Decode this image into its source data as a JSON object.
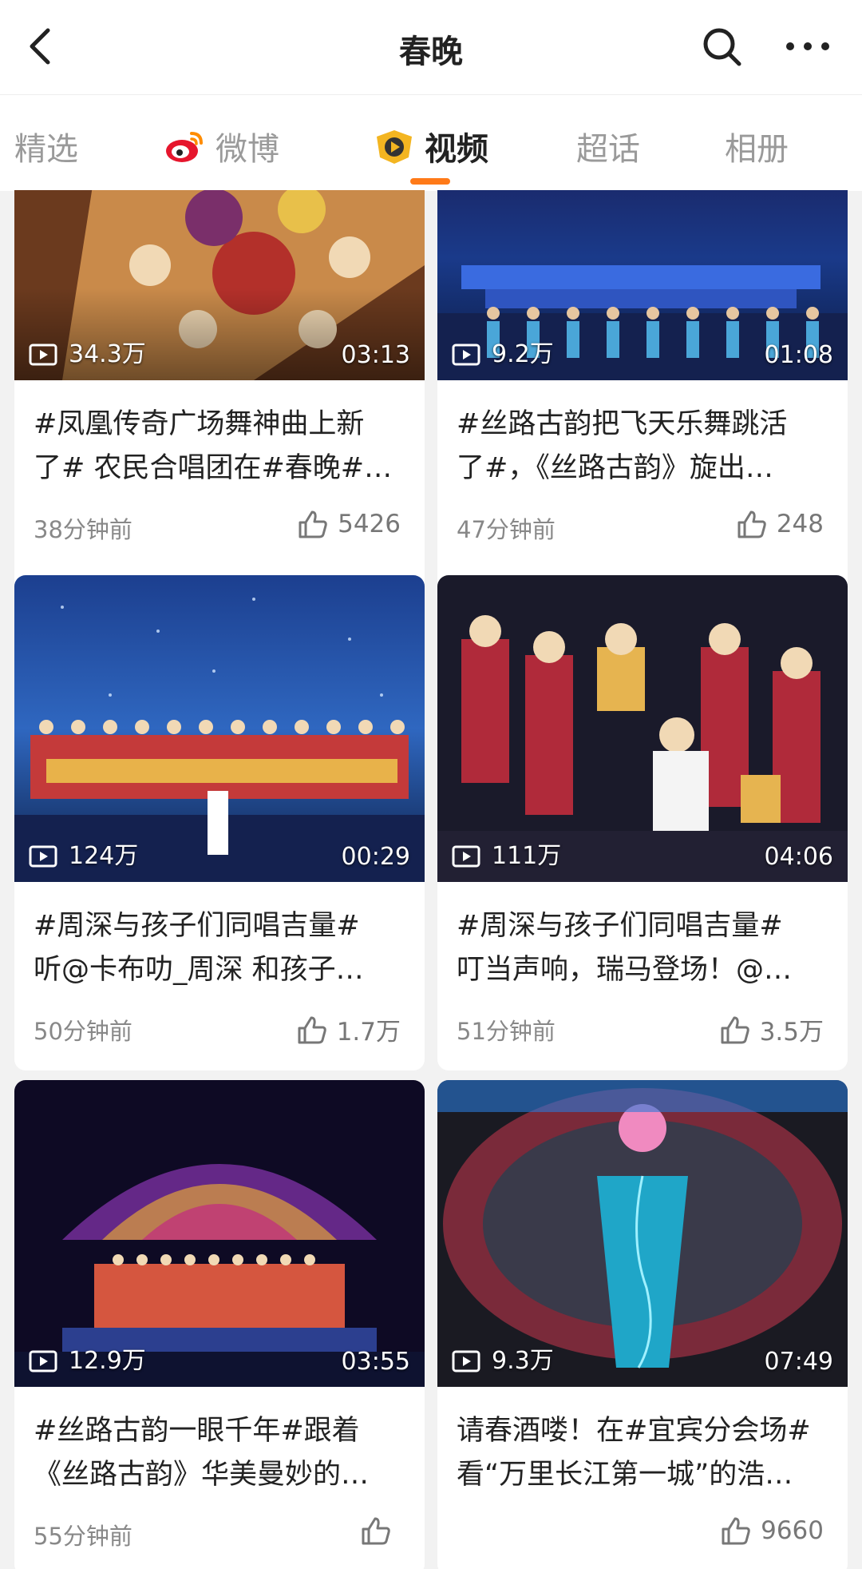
{
  "header": {
    "title": "春晚",
    "back_icon": "chevron-left-icon",
    "search_icon": "search-icon",
    "more_icon": "more-horizontal-icon"
  },
  "tabs": [
    {
      "label": "精选",
      "active": false
    },
    {
      "label": "微博",
      "active": false,
      "icon": "weibo-logo-icon"
    },
    {
      "label": "视频",
      "active": true,
      "icon": "video-play-icon"
    },
    {
      "label": "超话",
      "active": false
    },
    {
      "label": "相册",
      "active": false
    }
  ],
  "accent_color": "#ff7a18",
  "cards": [
    {
      "views": "34.3万",
      "duration": "03:13",
      "title_line1": "#凤凰传奇广场舞神曲上新",
      "title_line2": "了# 农民合唱团在#春晚#…",
      "time": "38分钟前",
      "likes": "5426"
    },
    {
      "views": "9.2万",
      "duration": "01:08",
      "title_line1": "#丝路古韵把飞天乐舞跳活",
      "title_line2": "了#，《丝路古韵》旋出…",
      "time": "47分钟前",
      "likes": "248"
    },
    {
      "views": "124万",
      "duration": "00:29",
      "title_line1": "#周深与孩子们同唱吉量#",
      "title_line2": "听@卡布叻_周深 和孩子…",
      "time": "50分钟前",
      "likes": "1.7万"
    },
    {
      "views": "111万",
      "duration": "04:06",
      "title_line1": "#周深与孩子们同唱吉量#",
      "title_line2": "叮当声响，瑞马登场！@…",
      "time": "51分钟前",
      "likes": "3.5万"
    },
    {
      "views": "12.9万",
      "duration": "03:55",
      "title_line1": "#丝路古韵一眼千年#跟着",
      "title_line2": "《丝路古韵》华美曼妙的…",
      "time": "55分钟前",
      "likes": ""
    },
    {
      "views": "9.3万",
      "duration": "07:49",
      "title_line1": "请春酒喽！在#宜宾分会场#",
      "title_line2": "看“万里长江第一城”的浩…",
      "time": "",
      "likes": "9660"
    }
  ]
}
